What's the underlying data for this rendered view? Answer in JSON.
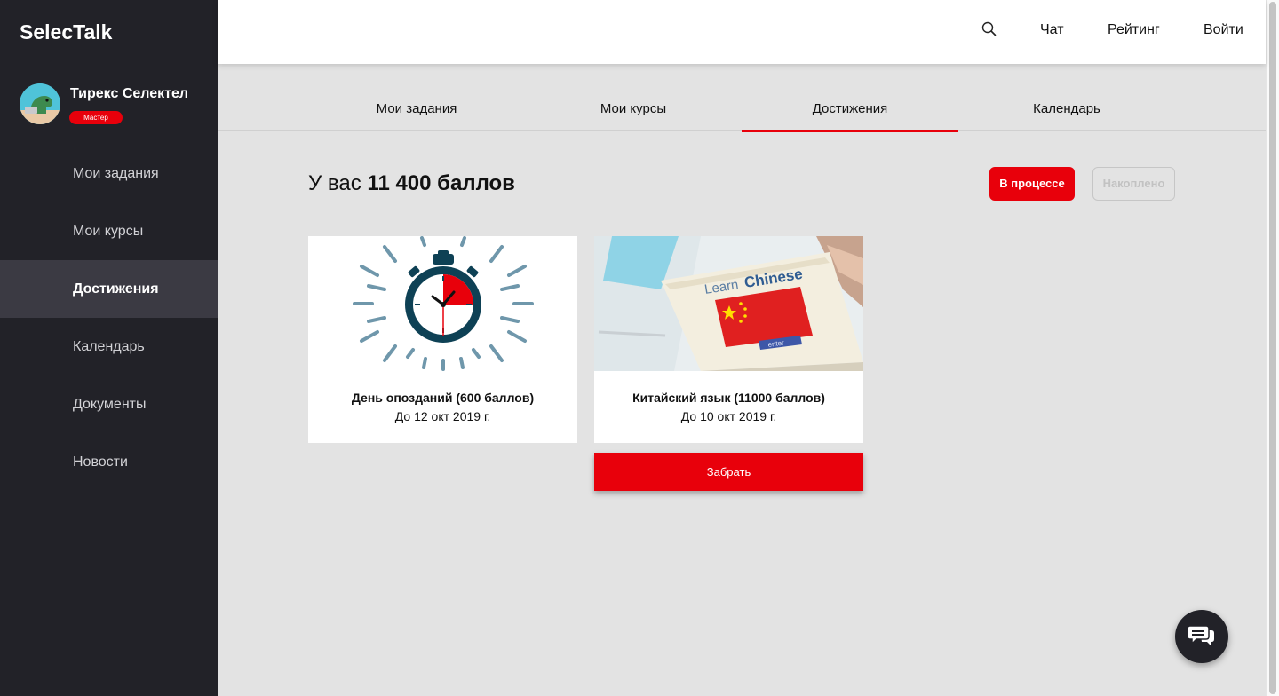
{
  "app": {
    "logo": "SelecTalk"
  },
  "user": {
    "name": "Тирекс Селектел",
    "role": "Мастер"
  },
  "sidebar": {
    "items": [
      {
        "label": "Мои задания"
      },
      {
        "label": "Мои курсы"
      },
      {
        "label": "Достижения",
        "active": true
      },
      {
        "label": "Календарь"
      },
      {
        "label": "Документы"
      },
      {
        "label": "Новости"
      }
    ]
  },
  "header": {
    "search_icon": "search-icon",
    "links": {
      "chat": "Чат",
      "rating": "Рейтинг",
      "login": "Войти"
    }
  },
  "tabs": [
    {
      "label": "Мои задания"
    },
    {
      "label": "Мои курсы"
    },
    {
      "label": "Достижения",
      "active": true
    },
    {
      "label": "Календарь"
    }
  ],
  "summary": {
    "prefix": "У вас ",
    "points": "11 400 баллов"
  },
  "filters": {
    "in_progress": "В процессе",
    "accumulated": "Накоплено"
  },
  "cards": [
    {
      "title": "День опозданий (600 баллов)",
      "date": "До 12 окт 2019 г.",
      "image": "stopwatch"
    },
    {
      "title": "Китайский язык (11000 баллов)",
      "date": "До 10 окт 2019 г.",
      "image": "learn-chinese-book",
      "image_text": {
        "learn": "Learn",
        "chinese": "Chinese",
        "enter": "enter"
      }
    }
  ],
  "claim_button": "Забрать",
  "colors": {
    "accent": "#e8000b",
    "sidebar": "#222228",
    "sidebar_active": "#3b3a43",
    "content_bg": "#e3e3e3"
  }
}
